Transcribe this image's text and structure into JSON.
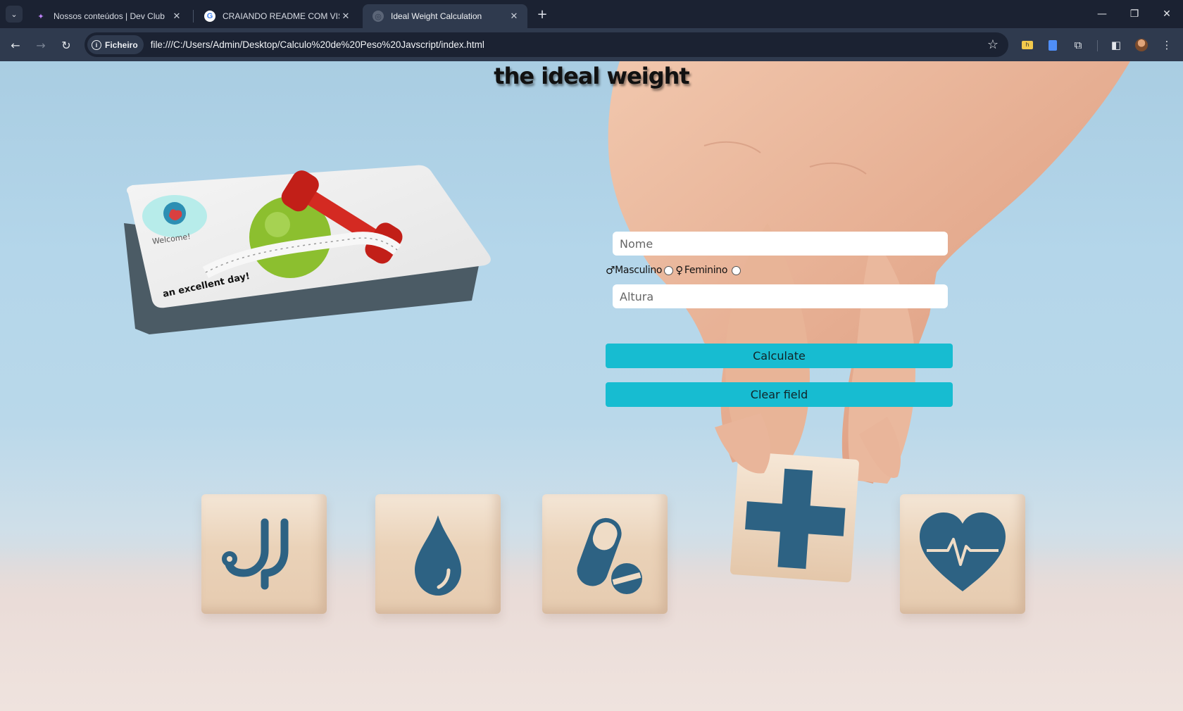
{
  "browser": {
    "tabs": [
      {
        "title": "Nossos conteúdos | Dev Club",
        "favicon": "devclub-icon",
        "active": false
      },
      {
        "title": "CRAIANDO README COM VISUAL STUDIO",
        "favicon": "google-icon",
        "active": false
      },
      {
        "title": "Ideal Weight Calculation",
        "favicon": "globe-icon",
        "active": true
      }
    ],
    "site_chip": "Ficheiro",
    "url": "file:///C:/Users/Admin/Desktop/Calculo%20de%20Peso%20Javscript/index.html"
  },
  "page": {
    "title": "the ideal weight",
    "card": {
      "welcome": "Welcome!",
      "tagline": "an excellent day!"
    },
    "form": {
      "name_placeholder": "Nome",
      "male_symbol": "♂",
      "male_label": "Masculino",
      "female_symbol": "♀",
      "female_label": "Feminino",
      "height_placeholder": "Altura",
      "calculate_label": "Calculate",
      "clear_label": "Clear field"
    },
    "cube_icons": [
      "stethoscope-icon",
      "water-drop-icon",
      "pill-icon",
      "medical-cross-icon",
      "heart-pulse-icon"
    ]
  },
  "colors": {
    "button": "#17bcd1",
    "icon_blue": "#2d6283",
    "tab_bar": "#1b2232",
    "toolbar": "#2f3a4e"
  }
}
